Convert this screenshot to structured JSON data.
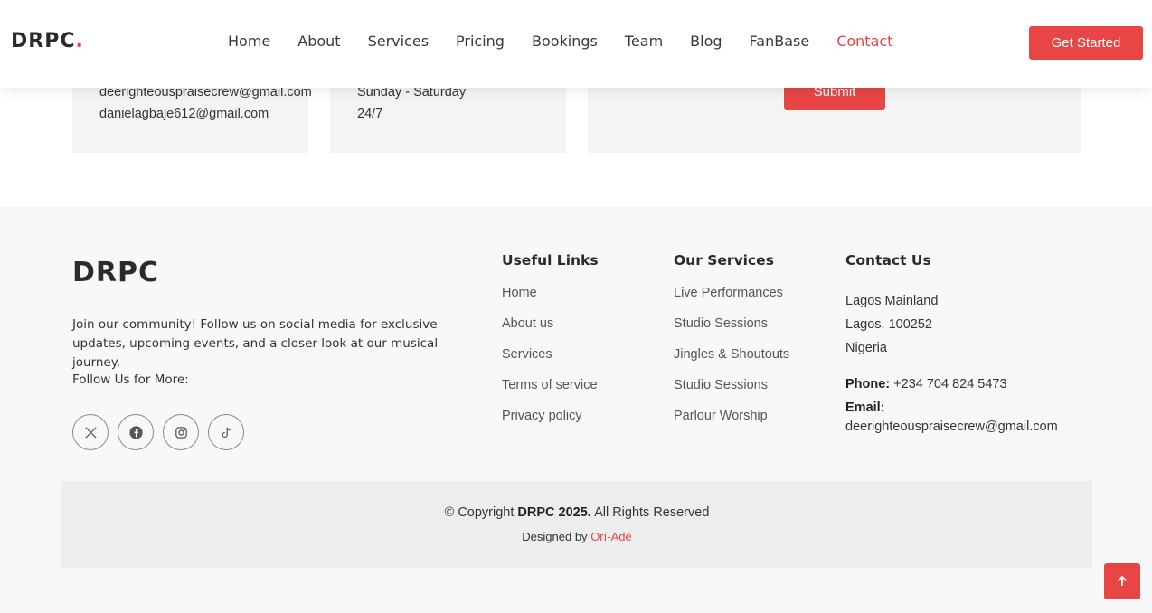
{
  "header": {
    "logo_text": "DRPC",
    "logo_dot": ".",
    "nav": [
      {
        "label": "Home"
      },
      {
        "label": "About"
      },
      {
        "label": "Services"
      },
      {
        "label": "Pricing"
      },
      {
        "label": "Bookings"
      },
      {
        "label": "Team"
      },
      {
        "label": "Blog"
      },
      {
        "label": "FanBase"
      },
      {
        "label": "Contact",
        "active": true
      }
    ],
    "cta_label": "Get Started"
  },
  "contact_cards": {
    "emails": [
      "deerighteouspraisecrew@gmail.com",
      "danielagbaje612@gmail.com"
    ],
    "hours": [
      "Sunday - Saturday",
      "24/7"
    ],
    "submit_label": "Submit"
  },
  "footer": {
    "logo_text": "DRPC",
    "about": "Join our community! Follow us on social media for exclusive updates, upcoming events, and a closer look at our musical journey.",
    "follow": "Follow Us for More:",
    "socials": [
      "x-icon",
      "facebook-icon",
      "instagram-icon",
      "tiktok-icon"
    ],
    "useful_links": {
      "title": "Useful Links",
      "items": [
        "Home",
        "About us",
        "Services",
        "Terms of service",
        "Privacy policy"
      ]
    },
    "our_services": {
      "title": "Our Services",
      "items": [
        "Live Performances",
        "Studio Sessions",
        "Jingles & Shoutouts",
        "Studio Sessions",
        "Parlour Worship"
      ]
    },
    "contact_us": {
      "title": "Contact Us",
      "address": [
        "Lagos Mainland",
        "Lagos, 100252",
        "Nigeria"
      ],
      "phone_label": "Phone:",
      "phone": "+234 704 824 5473",
      "email_label": "Email:",
      "email": "deerighteouspraisecrew@gmail.com"
    },
    "copyright": {
      "prefix": "© Copyright",
      "brand": "DRPC 2025.",
      "suffix": "All Rights Reserved",
      "designed_by": "Designed by",
      "designer": "Orí-Adé"
    }
  },
  "colors": {
    "accent": "#e84545",
    "footer_bg": "#f8f8f8",
    "copyright_bg": "#eceeee"
  }
}
